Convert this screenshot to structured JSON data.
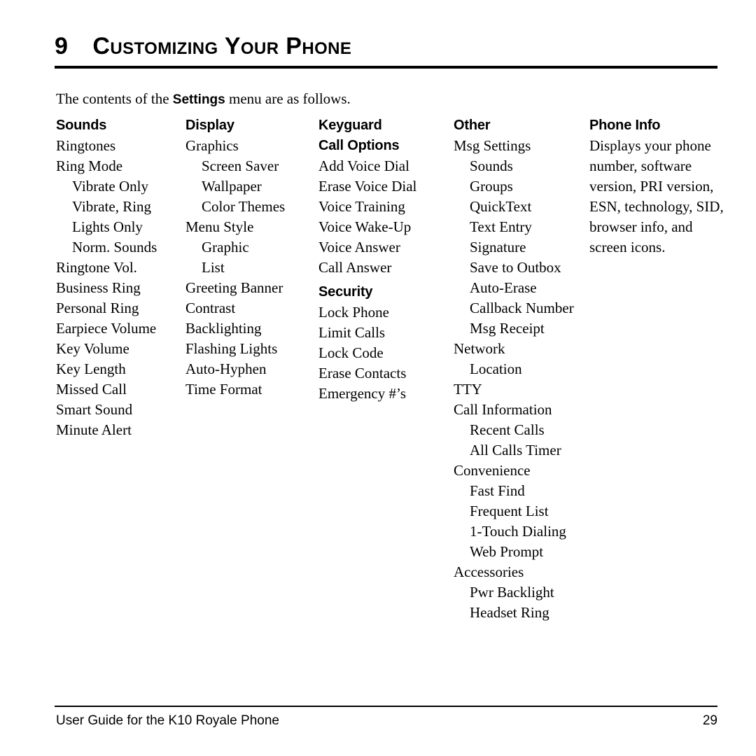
{
  "header": {
    "chapter_number": "9",
    "chapter_title": "Customizing Your Phone"
  },
  "intro": {
    "before": "The contents of the ",
    "emphasis": "Settings",
    "after": " menu are as follows."
  },
  "columns": [
    {
      "id": "sounds",
      "blocks": [
        {
          "type": "heading",
          "text": "Sounds"
        },
        {
          "type": "item",
          "level": 1,
          "text": "Ringtones"
        },
        {
          "type": "item",
          "level": 1,
          "text": "Ring Mode"
        },
        {
          "type": "item",
          "level": 2,
          "text": "Vibrate Only"
        },
        {
          "type": "item",
          "level": 2,
          "text": "Vibrate, Ring"
        },
        {
          "type": "item",
          "level": 2,
          "text": "Lights Only"
        },
        {
          "type": "item",
          "level": 2,
          "text": "Norm. Sounds"
        },
        {
          "type": "item",
          "level": 1,
          "text": "Ringtone Vol."
        },
        {
          "type": "item",
          "level": 1,
          "text": "Business Ring"
        },
        {
          "type": "item",
          "level": 1,
          "text": "Personal Ring"
        },
        {
          "type": "item",
          "level": 1,
          "text": "Earpiece Volume"
        },
        {
          "type": "item",
          "level": 1,
          "text": "Key Volume"
        },
        {
          "type": "item",
          "level": 1,
          "text": "Key Length"
        },
        {
          "type": "item",
          "level": 1,
          "text": "Missed Call"
        },
        {
          "type": "item",
          "level": 1,
          "text": "Smart Sound"
        },
        {
          "type": "item",
          "level": 1,
          "text": "Minute Alert"
        }
      ]
    },
    {
      "id": "display",
      "blocks": [
        {
          "type": "heading",
          "text": "Display"
        },
        {
          "type": "item",
          "level": 1,
          "text": "Graphics"
        },
        {
          "type": "item",
          "level": 2,
          "text": "Screen Saver"
        },
        {
          "type": "item",
          "level": 2,
          "text": "Wallpaper"
        },
        {
          "type": "item",
          "level": 2,
          "text": "Color Themes"
        },
        {
          "type": "item",
          "level": 1,
          "text": "Menu Style"
        },
        {
          "type": "item",
          "level": 2,
          "text": "Graphic"
        },
        {
          "type": "item",
          "level": 2,
          "text": "List"
        },
        {
          "type": "item",
          "level": 1,
          "text": "Greeting Banner"
        },
        {
          "type": "item",
          "level": 1,
          "text": "Contrast"
        },
        {
          "type": "item",
          "level": 1,
          "text": "Backlighting"
        },
        {
          "type": "item",
          "level": 1,
          "text": "Flashing Lights"
        },
        {
          "type": "item",
          "level": 1,
          "text": "Auto-Hyphen"
        },
        {
          "type": "item",
          "level": 1,
          "text": "Time Format"
        }
      ]
    },
    {
      "id": "keyguard",
      "blocks": [
        {
          "type": "heading",
          "text": "Keyguard"
        },
        {
          "type": "heading",
          "text": "Call Options"
        },
        {
          "type": "item",
          "level": 1,
          "text": "Add Voice Dial"
        },
        {
          "type": "item",
          "level": 1,
          "text": "Erase Voice Dial"
        },
        {
          "type": "item",
          "level": 1,
          "text": "Voice Training"
        },
        {
          "type": "item",
          "level": 1,
          "text": "Voice Wake-Up"
        },
        {
          "type": "item",
          "level": 1,
          "text": "Voice Answer"
        },
        {
          "type": "item",
          "level": 1,
          "text": "Call Answer"
        },
        {
          "type": "heading",
          "spaced": true,
          "text": "Security"
        },
        {
          "type": "item",
          "level": 1,
          "text": "Lock Phone"
        },
        {
          "type": "item",
          "level": 1,
          "text": "Limit Calls"
        },
        {
          "type": "item",
          "level": 1,
          "text": "Lock Code"
        },
        {
          "type": "item",
          "level": 1,
          "text": "Erase Contacts"
        },
        {
          "type": "item",
          "level": 1,
          "text": "Emergency #’s"
        }
      ]
    },
    {
      "id": "other",
      "blocks": [
        {
          "type": "heading",
          "text": "Other"
        },
        {
          "type": "item",
          "level": 1,
          "text": "Msg Settings"
        },
        {
          "type": "item",
          "level": 2,
          "text": "Sounds"
        },
        {
          "type": "item",
          "level": 2,
          "text": "Groups"
        },
        {
          "type": "item",
          "level": 2,
          "text": "QuickText"
        },
        {
          "type": "item",
          "level": 2,
          "text": "Text Entry"
        },
        {
          "type": "item",
          "level": 2,
          "text": "Signature"
        },
        {
          "type": "item",
          "level": 2,
          "text": "Save to Outbox"
        },
        {
          "type": "item",
          "level": 2,
          "text": "Auto-Erase"
        },
        {
          "type": "item",
          "level": 2,
          "text": "Callback Number"
        },
        {
          "type": "item",
          "level": 2,
          "text": "Msg Receipt"
        },
        {
          "type": "item",
          "level": 1,
          "text": "Network"
        },
        {
          "type": "item",
          "level": 2,
          "text": "Location"
        },
        {
          "type": "item",
          "level": 1,
          "text": "TTY"
        },
        {
          "type": "item",
          "level": 1,
          "text": "Call Information"
        },
        {
          "type": "item",
          "level": 2,
          "text": "Recent Calls"
        },
        {
          "type": "item",
          "level": 2,
          "text": "All Calls Timer"
        },
        {
          "type": "item",
          "level": 1,
          "text": "Convenience"
        },
        {
          "type": "item",
          "level": 2,
          "text": "Fast Find"
        },
        {
          "type": "item",
          "level": 2,
          "text": "Frequent List"
        },
        {
          "type": "item",
          "level": 2,
          "text": "1-Touch Dialing"
        },
        {
          "type": "item",
          "level": 2,
          "text": "Web Prompt"
        },
        {
          "type": "item",
          "level": 1,
          "text": "Accessories"
        },
        {
          "type": "item",
          "level": 2,
          "text": "Pwr Backlight"
        },
        {
          "type": "item",
          "level": 2,
          "text": "Headset Ring"
        }
      ]
    },
    {
      "id": "phone-info",
      "blocks": [
        {
          "type": "heading",
          "text": "Phone Info"
        },
        {
          "type": "paragraph",
          "text": "Displays your phone number, software version, PRI version, ESN, technology, SID, browser info, and screen icons."
        }
      ]
    }
  ],
  "footer": {
    "left": "User Guide for the K10 Royale Phone",
    "page_number": "29"
  }
}
